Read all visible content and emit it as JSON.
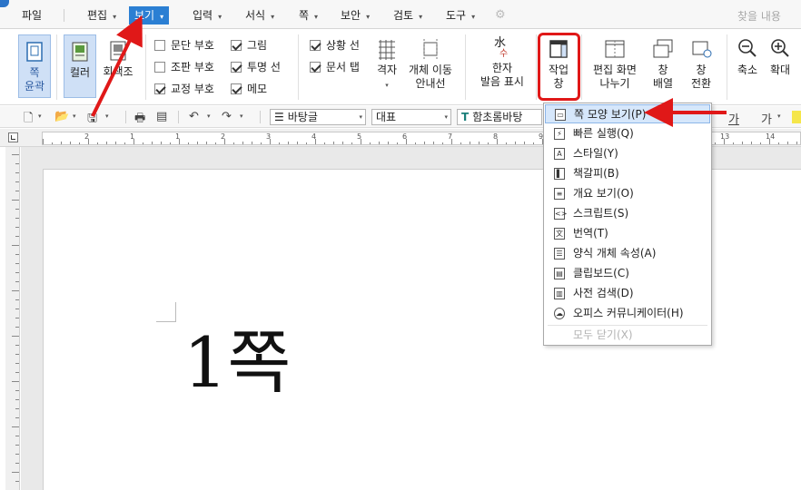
{
  "menubar": {
    "items": [
      {
        "label": "파일"
      },
      {
        "label": "편집",
        "caret": "▾"
      },
      {
        "label": "보기",
        "caret": "▾",
        "active": true
      },
      {
        "label": "입력",
        "caret": "▾"
      },
      {
        "label": "서식",
        "caret": "▾"
      },
      {
        "label": "쪽",
        "caret": "▾"
      },
      {
        "label": "보안",
        "caret": "▾"
      },
      {
        "label": "검토",
        "caret": "▾"
      },
      {
        "label": "도구",
        "caret": "▾"
      }
    ],
    "find_placeholder": "찾을 내용",
    "accent": "#2b7fd3"
  },
  "ribbon": {
    "page_outline": "쪽\n윤곽",
    "color": "컬러",
    "grayscale": "회색조",
    "checks_col1": [
      {
        "label": "문단 부호",
        "checked": false
      },
      {
        "label": "조판 부호",
        "checked": false
      },
      {
        "label": "교정 부호",
        "checked": true
      }
    ],
    "checks_col2": [
      {
        "label": "그림",
        "checked": true
      },
      {
        "label": "투명 선",
        "checked": true
      },
      {
        "label": "메모",
        "checked": true
      }
    ],
    "checks_col3": [
      {
        "label": "상황 선",
        "checked": true
      },
      {
        "label": "문서 탭",
        "checked": true
      }
    ],
    "grid": "격자",
    "move_guide": "개체 이동\n안내선",
    "hanja": "한자\n발음 표시",
    "hanja_glyph_top": "水",
    "hanja_glyph_bottom": "수",
    "task_pane": "작업\n창",
    "split_view": "편집 화면\n나누기",
    "arrange": "창\n배열",
    "switch": "창\n전환",
    "zoom_out": "축소",
    "zoom_in": "확대"
  },
  "toolbar": {
    "style": "바탕글",
    "rep": "대표",
    "font": "함초롬바탕",
    "font_badge": "T",
    "right_a": "가",
    "right_b": "가"
  },
  "ruler": {
    "numbers": [
      "2",
      "1",
      "1",
      "2",
      "3",
      "4",
      "5",
      "6",
      "7",
      "8",
      "9",
      "10",
      "11",
      "12",
      "13",
      "14"
    ]
  },
  "document": {
    "text": "1쪽"
  },
  "dropdown": {
    "items": [
      {
        "label": "쪽 모양 보기(P)",
        "icon": "▭",
        "highlighted": true
      },
      {
        "label": "빠른 실행(Q)",
        "icon": "⚡"
      },
      {
        "label": "스타일(Y)",
        "icon": "A"
      },
      {
        "label": "책갈피(B)",
        "icon": "▌"
      },
      {
        "label": "개요 보기(O)",
        "icon": "≡"
      },
      {
        "label": "스크립트(S)",
        "icon": "<>"
      },
      {
        "label": "번역(T)",
        "icon": "文"
      },
      {
        "label": "양식 개체 속성(A)",
        "icon": "☰"
      },
      {
        "label": "클립보드(C)",
        "icon": "▤"
      },
      {
        "label": "사전 검색(D)",
        "icon": "▥"
      },
      {
        "label": "오피스 커뮤니케이터(H)",
        "icon": "☁"
      },
      {
        "label": "모두 닫기(X)",
        "disabled": true
      }
    ]
  },
  "annotation_color": "#e01818"
}
